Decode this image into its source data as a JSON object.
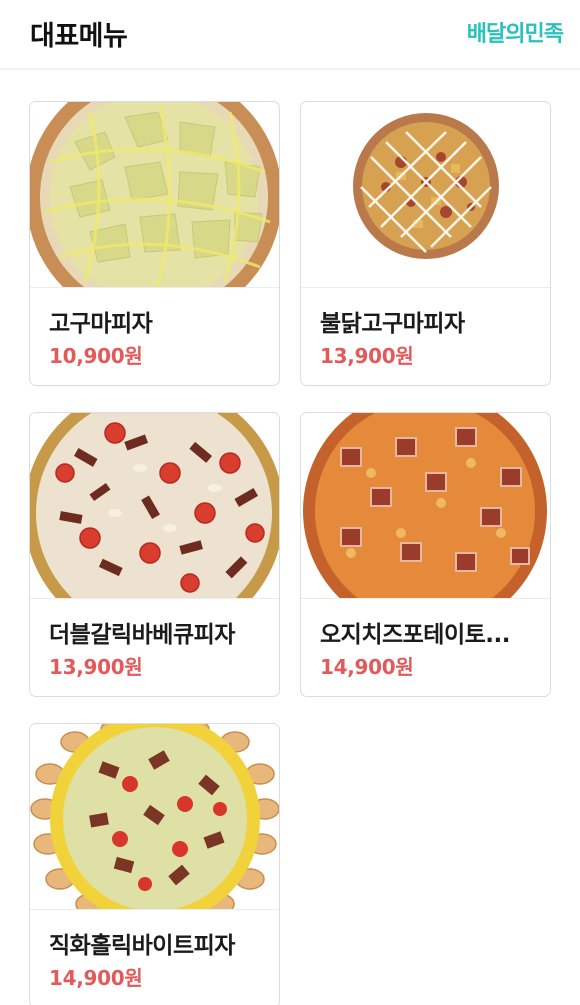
{
  "header": {
    "title": "대표메뉴",
    "brand": "배달의민족",
    "brand_color": "#2ac1bc"
  },
  "menu": {
    "price_color": "#e25a5a",
    "items": [
      {
        "name": "고구마피자",
        "price": "10,900원",
        "image": "sweet-potato-pizza-image"
      },
      {
        "name": "불닭고구마피자",
        "price": "13,900원",
        "image": "fire-chicken-sweet-potato-pizza-image"
      },
      {
        "name": "더블갈릭바베큐피자",
        "price": "13,900원",
        "image": "double-garlic-bbq-pizza-image"
      },
      {
        "name": "오지치즈포테이토...",
        "price": "14,900원",
        "image": "ozzy-cheese-potato-pizza-image"
      },
      {
        "name": "직화홀릭바이트피자",
        "price": "14,900원",
        "image": "grilled-holic-bite-pizza-image"
      }
    ]
  }
}
